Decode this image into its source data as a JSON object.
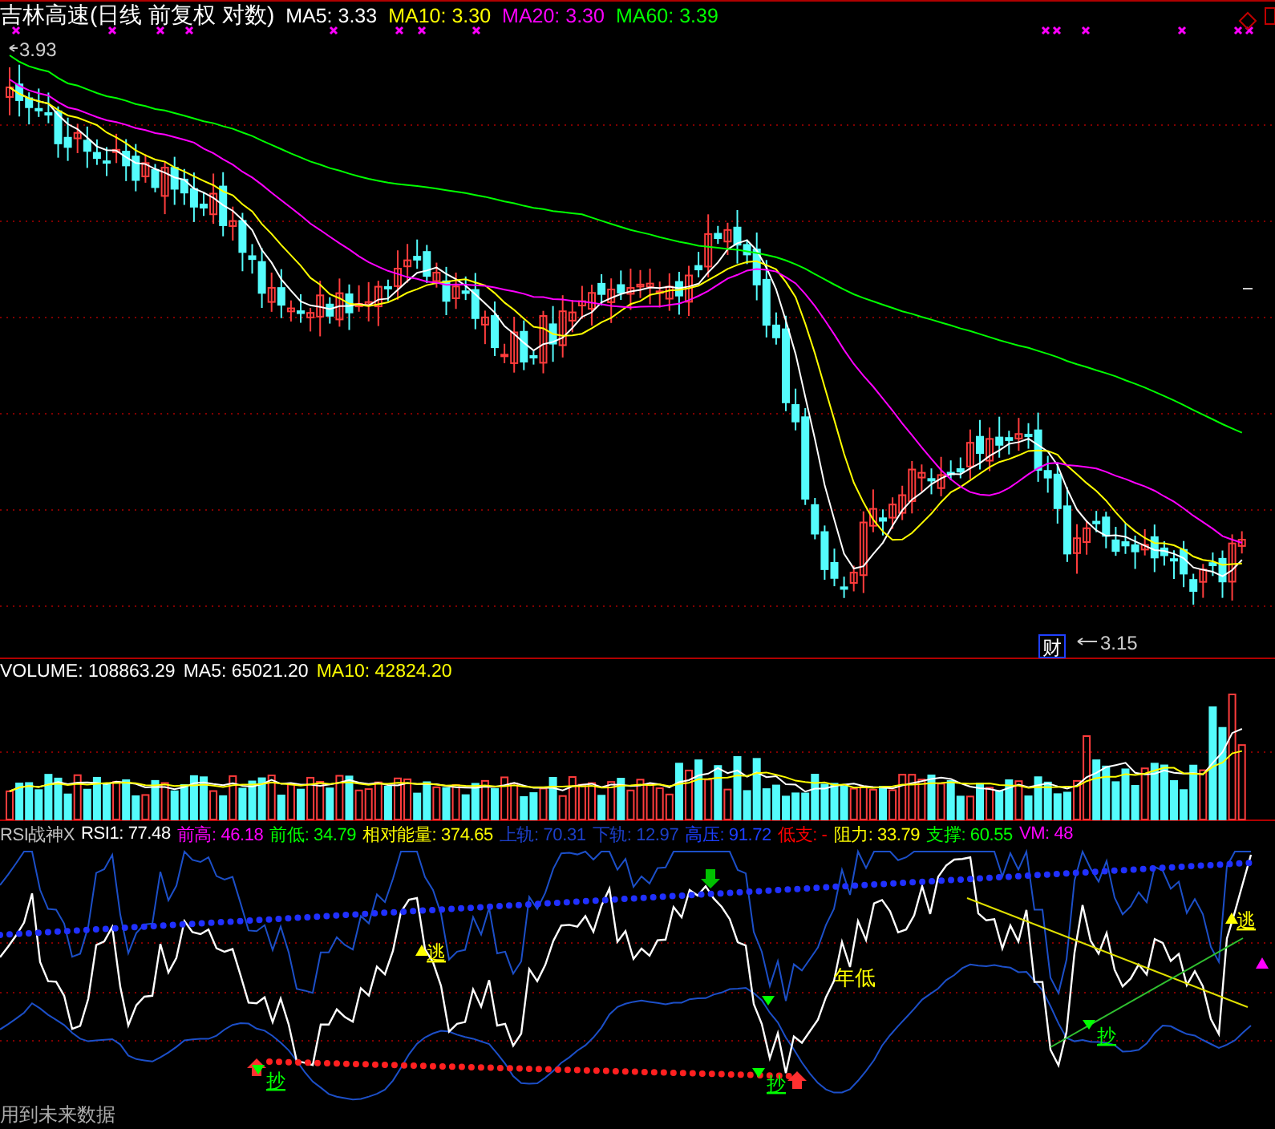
{
  "header": {
    "title": "吉林高速(日线 前复权 对数)",
    "indicators": [
      {
        "label": "MA5: 3.33",
        "color": "#ffffff"
      },
      {
        "label": "MA10: 3.30",
        "color": "#ffff00"
      },
      {
        "label": "MA20: 3.30",
        "color": "#ff00ff"
      },
      {
        "label": "MA60: 3.39",
        "color": "#00ff00"
      }
    ]
  },
  "price_chart": {
    "high_label": "3.93",
    "low_label": "3.15",
    "event_badge": "财"
  },
  "volume": {
    "indicators": [
      {
        "label": "VOLUME: 108863.29",
        "color": "#ffffff"
      },
      {
        "label": "MA5: 65021.20",
        "color": "#ffffff"
      },
      {
        "label": "MA10: 42824.20",
        "color": "#ffff00"
      }
    ]
  },
  "rsi": {
    "indicators": [
      {
        "label": "RSI战神X",
        "color": "#c0c0c0"
      },
      {
        "label": "RSI1: 77.48",
        "color": "#ffffff"
      },
      {
        "label": "前高: 46.18",
        "color": "#ff00ff"
      },
      {
        "label": "前低: 34.79",
        "color": "#00ff00"
      },
      {
        "label": "相对能量: 374.65",
        "color": "#ffff00"
      },
      {
        "label": "上轨: 70.31",
        "color": "#1c3fc8"
      },
      {
        "label": "下轨: 12.97",
        "color": "#1c3fc8"
      },
      {
        "label": "高压: 91.72",
        "color": "#1c3fff"
      },
      {
        "label": "低支: -",
        "color": "#ff0000"
      },
      {
        "label": "阻力: 33.79",
        "color": "#ffff00"
      },
      {
        "label": "支撑: 60.55",
        "color": "#00ff00"
      },
      {
        "label": "VM: 48",
        "color": "#ff00ff"
      }
    ],
    "signals": [
      {
        "kind": "escape",
        "label": "逃"
      },
      {
        "kind": "buy",
        "label": "抄"
      },
      {
        "kind": "buy",
        "label": "抄"
      },
      {
        "kind": "buy",
        "label": "抄"
      },
      {
        "kind": "escape",
        "label": "逃"
      }
    ],
    "note": "年低",
    "footer": "用到未来数据"
  }
}
